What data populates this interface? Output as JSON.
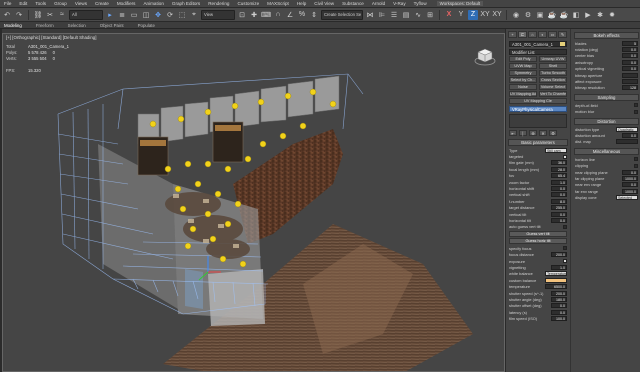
{
  "menubar": {
    "items": [
      "File",
      "Edit",
      "Tools",
      "Group",
      "Views",
      "Create",
      "Modifiers",
      "Animation",
      "Graph Editors",
      "Rendering",
      "Customize",
      "MAXScript",
      "Help",
      "Civil View",
      "Substance",
      "Arnold",
      "V-Ray",
      "Tyflow"
    ],
    "workspace_label": "Workspaces: Default"
  },
  "toolbar": {
    "selection_filter": "All",
    "view_dropdown": "View",
    "named_selection": "Create Selection Se",
    "axis_labels": [
      "X",
      "Y",
      "Z",
      "XY",
      "XY"
    ]
  },
  "ribbon": {
    "tabs": [
      "Modeling",
      "Freeform",
      "Selection",
      "Object Paint",
      "Populate"
    ]
  },
  "viewport": {
    "label": "[+] [Orthographic] [Standard] [Default Shading]",
    "stats": {
      "total_label": "Total",
      "object_name": "A301_001_Camera_1",
      "polys_label": "Polys:",
      "polys_total": "5 578 426",
      "polys_selected": "0",
      "verts_label": "Verts:",
      "verts_total": "3 555 504",
      "verts_selected": "0",
      "fps_label": "FPS:",
      "fps_value": "15.320"
    }
  },
  "panel": {
    "tabs": [
      "+",
      "⊏",
      "⌂",
      "◐",
      "▭",
      "✎"
    ],
    "object_name": "A301_001_Camera_1",
    "modifier_list": "Modifier List",
    "modifier_buttons": [
      "Edit Poly",
      "Unwrap UVW",
      "UVW Map",
      "Shell",
      "Symmetry",
      "Turbo Smooth",
      "Select by Ch...",
      "Cross Section",
      "Noise",
      "Volume Select"
    ],
    "uv_mapping_label": "UV Mapping Add",
    "uv_mapping_label2": "UV Mapping Cle",
    "vertex_chamfer": "Vert To Chamfer",
    "stack_item": "VRayPhysicalCamera",
    "stack_icons": [
      "⇤",
      "│",
      "⊕",
      "✕",
      "⚙"
    ],
    "basic_params": {
      "title": "Basic parameters",
      "type_label": "Type",
      "type_value": "Still cam",
      "rows": [
        {
          "label": "targeted",
          "type": "check",
          "checked": true
        },
        {
          "label": "film gate (mm)",
          "value": "36.0"
        },
        {
          "label": "focal length (mm)",
          "value": "28.0"
        },
        {
          "label": "fov",
          "value": "65.4"
        },
        {
          "label": "zoom factor",
          "value": "1.0"
        },
        {
          "label": "horizontal shift",
          "value": "0.0"
        },
        {
          "label": "vertical shift",
          "value": "0.0"
        },
        {
          "label": "f-number",
          "value": "8.0"
        },
        {
          "label": "target distance",
          "value": "255.0"
        },
        {
          "label": "vertical tilt",
          "value": "0.0"
        },
        {
          "label": "horizontal tilt",
          "value": "0.0"
        },
        {
          "label": "auto guess vert tilt",
          "type": "check",
          "checked": false
        }
      ],
      "guess_vert_tilt": "Guess vert tilt",
      "guess_horiz_tilt": "Guess horiz tilt",
      "rows2": [
        {
          "label": "specify focus",
          "type": "check",
          "checked": false
        },
        {
          "label": "focus distance",
          "value": "200.0"
        },
        {
          "label": "exposure",
          "type": "check",
          "checked": true
        },
        {
          "label": "vignetting",
          "value": "1.0"
        }
      ],
      "white_balance_label": "white balance",
      "white_balance_value": "Temperature",
      "custom_balance_label": "custom balance",
      "temperature_label": "temperature",
      "temperature_value": "6500.0",
      "shutter_rows": [
        {
          "label": "shutter speed (s^-1)",
          "value": "200.0"
        },
        {
          "label": "shutter angle (deg)",
          "value": "180.0"
        },
        {
          "label": "shutter offset (deg)",
          "value": "0.0"
        },
        {
          "label": "latency (s)",
          "value": "0.0"
        },
        {
          "label": "film speed (ISO)",
          "value": "100.0"
        }
      ]
    },
    "bokeh": {
      "title": "Bokeh effects",
      "rows": [
        {
          "label": "blades",
          "value": "5"
        },
        {
          "label": "rotation (deg)",
          "value": "0.0"
        },
        {
          "label": "center bias",
          "value": "0.0"
        },
        {
          "label": "anisotropy",
          "value": "0.0"
        },
        {
          "label": "optical vignetting",
          "value": "0.0"
        },
        {
          "label": "bitmap aperture",
          "value": ""
        },
        {
          "label": "affect exposure",
          "value": ""
        },
        {
          "label": "bitmap resolution",
          "value": "128"
        }
      ]
    },
    "sampling": {
      "title": "Sampling",
      "rows": [
        {
          "label": "depth-of-field",
          "type": "check",
          "checked": false
        },
        {
          "label": "motion blur",
          "type": "check",
          "checked": false
        }
      ]
    },
    "distortion": {
      "title": "Distortion",
      "type_label": "distortion type",
      "type_value": "Quadratic",
      "amount_label": "distortion amount",
      "amount_value": "0.0",
      "map_label": "dist. map"
    },
    "misc": {
      "title": "Miscellaneous",
      "rows": [
        {
          "label": "horizon line",
          "type": "check",
          "checked": false
        },
        {
          "label": "clipping",
          "type": "check",
          "checked": false
        },
        {
          "label": "near clipping plane",
          "value": "0.0"
        },
        {
          "label": "far clipping plane",
          "value": "1000.0"
        },
        {
          "label": "near env range",
          "value": "0.0"
        },
        {
          "label": "far env range",
          "value": "1000.0"
        }
      ],
      "display_cone_label": "display cone",
      "display_cone_value": "Selected"
    }
  }
}
